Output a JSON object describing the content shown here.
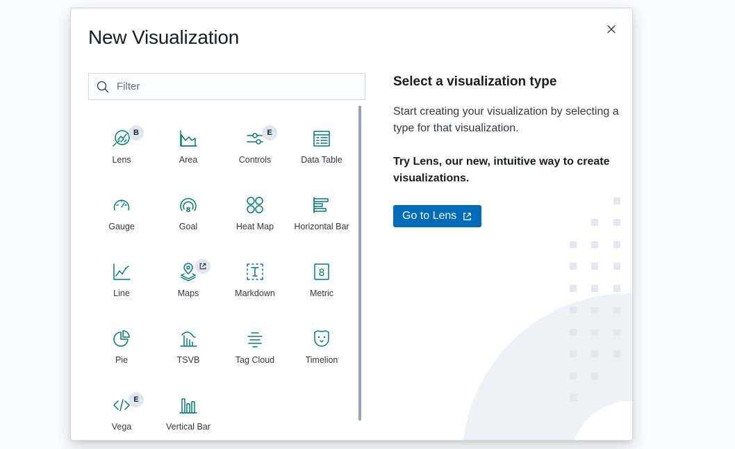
{
  "modal": {
    "title": "New Visualization",
    "close_icon": "close-icon"
  },
  "search": {
    "placeholder": "Filter",
    "value": "",
    "icon": "search-icon"
  },
  "tiles": [
    {
      "label": "Lens",
      "icon": "lens-icon",
      "badge": "B"
    },
    {
      "label": "Area",
      "icon": "area-chart-icon",
      "badge": ""
    },
    {
      "label": "Controls",
      "icon": "controls-icon",
      "badge": "E"
    },
    {
      "label": "Data Table",
      "icon": "data-table-icon",
      "badge": ""
    },
    {
      "label": "Gauge",
      "icon": "gauge-icon",
      "badge": ""
    },
    {
      "label": "Goal",
      "icon": "goal-icon",
      "badge": ""
    },
    {
      "label": "Heat Map",
      "icon": "heat-map-icon",
      "badge": ""
    },
    {
      "label": "Horizontal Bar",
      "icon": "horizontal-bar-icon",
      "badge": ""
    },
    {
      "label": "Line",
      "icon": "line-chart-icon",
      "badge": ""
    },
    {
      "label": "Maps",
      "icon": "maps-icon",
      "badge_icon": "external-link-icon"
    },
    {
      "label": "Markdown",
      "icon": "markdown-icon",
      "badge": ""
    },
    {
      "label": "Metric",
      "icon": "metric-icon",
      "badge": ""
    },
    {
      "label": "Pie",
      "icon": "pie-chart-icon",
      "badge": ""
    },
    {
      "label": "TSVB",
      "icon": "tsvb-icon",
      "badge": ""
    },
    {
      "label": "Tag Cloud",
      "icon": "tag-cloud-icon",
      "badge": ""
    },
    {
      "label": "Timelion",
      "icon": "timelion-icon",
      "badge": ""
    },
    {
      "label": "Vega",
      "icon": "vega-icon",
      "badge": "E"
    },
    {
      "label": "Vertical Bar",
      "icon": "vertical-bar-icon",
      "badge": ""
    }
  ],
  "side_panel": {
    "title": "Select a visualization type",
    "description": "Start creating your visualization by selecting a type for that visualization.",
    "cta_text": "Try Lens, our new, intuitive way to create visualizations.",
    "button_label": "Go to Lens",
    "button_icon": "external-link-icon"
  },
  "colors": {
    "icon_teal": "#017d73",
    "primary_button": "#006bb8",
    "badge_bg": "#e0e5ee",
    "decor": "#e9edf3"
  }
}
